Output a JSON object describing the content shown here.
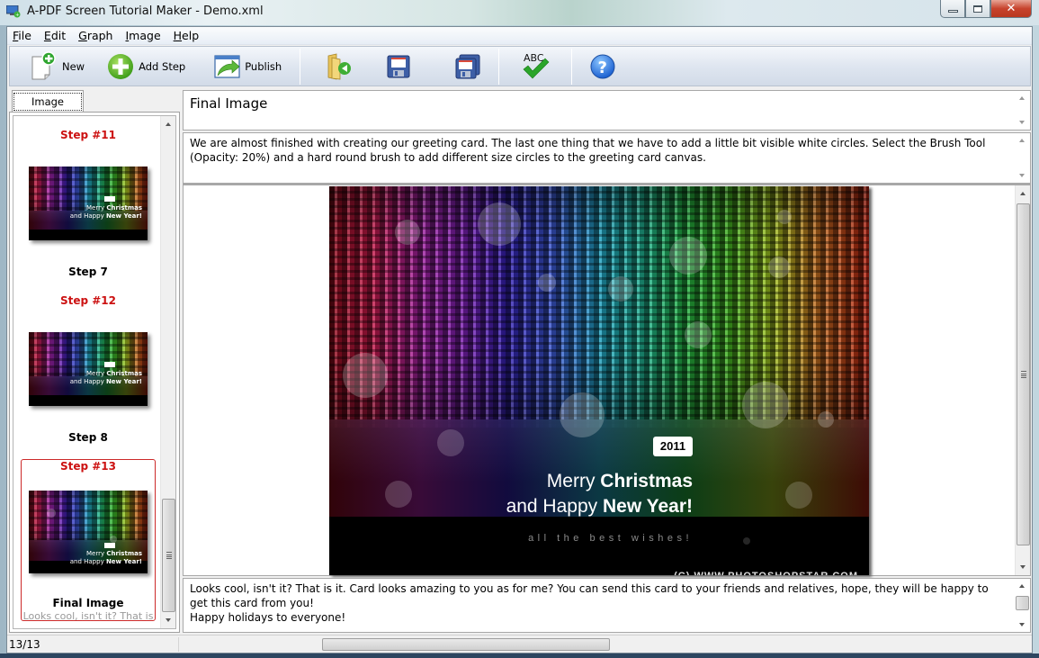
{
  "window": {
    "title": "A-PDF Screen Tutorial Maker - Demo.xml",
    "controls": {
      "minimize": "minimize",
      "maximize": "maximize",
      "close": "close"
    }
  },
  "menu": [
    {
      "label": "File",
      "accel": "F",
      "rest": "ile"
    },
    {
      "label": "Edit",
      "accel": "E",
      "rest": "dit"
    },
    {
      "label": "Graph",
      "accel": "G",
      "rest": "raph"
    },
    {
      "label": "Image",
      "accel": "I",
      "rest": "mage"
    },
    {
      "label": "Help",
      "accel": "H",
      "rest": "elp"
    }
  ],
  "toolbar": {
    "new_label": "New",
    "add_step_label": "Add Step",
    "publish_label": "Publish",
    "open_icon": "open-folder-icon",
    "save_icon": "save-icon",
    "save_as_icon": "save-as-icon",
    "spellcheck_icon": "spellcheck-icon",
    "spellcheck_text": "ABC",
    "help_icon": "help-icon",
    "help_glyph": "?"
  },
  "left_panel": {
    "tab_label": "Image",
    "items": [
      {
        "step_label": "Step #11",
        "title": "Step 7"
      },
      {
        "step_label": "Step #12",
        "title": "Step 8"
      },
      {
        "step_label": "Step #13",
        "title": "Final Image",
        "desc": "Looks cool, isn't it? That is",
        "selected": true
      }
    ]
  },
  "main": {
    "title": "Final Image",
    "description": "We are almost finished with creating our greeting card. The last one thing that we have to add a little bit visible white circles. Select the Brush Tool (Opacity: 20%) and a hard round brush to add different size circles to the greeting card canvas.",
    "card": {
      "year": "2011",
      "line1_regular": "Merry ",
      "line1_bold": "Christmas",
      "line2_regular": "and Happy ",
      "line2_bold": "New Year!",
      "wishes": "all the best wishes!",
      "copyright": "(C) WWW.PHOTOSHOPSTAR.COM"
    },
    "footer_line1": "Looks cool, isn't it? That is it. Card looks amazing to you as for me? You can send this card to your friends and relatives, hope, they will be happy to get this card from you!",
    "footer_line2": "Happy holidays to everyone!"
  },
  "status": {
    "page": "13/13"
  },
  "colors": {
    "step_accent": "#cc1111",
    "selection_border": "#cc2a2a"
  }
}
